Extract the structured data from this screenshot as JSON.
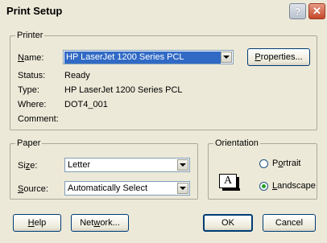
{
  "window": {
    "title": "Print Setup"
  },
  "printer": {
    "legend": "Printer",
    "name_label": "Name:",
    "name_value": "HP LaserJet 1200 Series PCL",
    "properties_button": "Properties...",
    "status_label": "Status:",
    "status_value": "Ready",
    "type_label": "Type:",
    "type_value": "HP LaserJet 1200 Series PCL",
    "where_label": "Where:",
    "where_value": "DOT4_001",
    "comment_label": "Comment:",
    "comment_value": ""
  },
  "paper": {
    "legend": "Paper",
    "size_label": "Size:",
    "size_value": "Letter",
    "source_label": "Source:",
    "source_value": "Automatically Select"
  },
  "orientation": {
    "legend": "Orientation",
    "icon_letter": "A",
    "portrait_label": "Portrait",
    "landscape_label": "Landscape",
    "selected": "Landscape"
  },
  "buttons": {
    "help": "Help",
    "network": "Network...",
    "ok": "OK",
    "cancel": "Cancel"
  },
  "icons": {
    "help": "?",
    "close": "✕"
  }
}
